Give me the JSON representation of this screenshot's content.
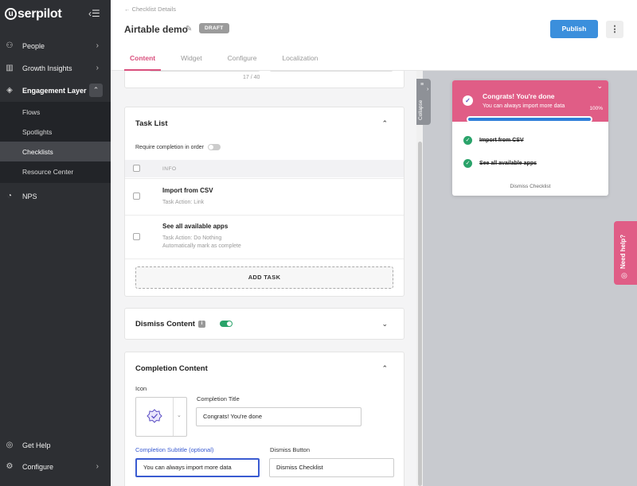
{
  "sidebar": {
    "logo": "serpilot",
    "logo_letter": "u",
    "collapse_icon": "‹☰",
    "items": [
      {
        "label": "People",
        "icon": "people-icon"
      },
      {
        "label": "Growth Insights",
        "icon": "chart-icon"
      },
      {
        "label": "Engagement Layer",
        "icon": "layers-icon"
      },
      {
        "label": "NPS",
        "icon": "nps-icon"
      }
    ],
    "subitems": [
      {
        "label": "Flows"
      },
      {
        "label": "Spotlights"
      },
      {
        "label": "Checklists"
      },
      {
        "label": "Resource Center"
      }
    ],
    "footer": [
      {
        "label": "Get Help",
        "icon": "help-icon"
      },
      {
        "label": "Configure",
        "icon": "gear-icon"
      }
    ]
  },
  "header": {
    "back_label": "← Checklist Details",
    "title": "Airtable demo",
    "badge": "DRAFT",
    "publish": "Publish",
    "more": "⋮",
    "tabs": [
      {
        "label": "Content"
      },
      {
        "label": "Widget"
      },
      {
        "label": "Configure"
      },
      {
        "label": "Localization"
      }
    ]
  },
  "content": {
    "char_count": "17 / 40",
    "task_list": {
      "title": "Task List",
      "require_completion": "Require completion in order",
      "require_completion_on": false,
      "column_header": "INFO",
      "tasks": [
        {
          "name": "Import from CSV",
          "action": "Task Action: Link",
          "extra": ""
        },
        {
          "name": "See all available apps",
          "action": "Task Action: Do Nothing",
          "extra": "Automatically mark as complete"
        }
      ],
      "add_task": "ADD TASK"
    },
    "dismiss": {
      "title": "Dismiss Content",
      "info": "i",
      "enabled": true
    },
    "completion": {
      "title": "Completion Content",
      "icon_label": "Icon",
      "title_label": "Completion Title",
      "title_value": "Congrats! You're done",
      "subtitle_label": "Completion Subtitle (optional)",
      "subtitle_value": "You can always import more data",
      "dismiss_label": "Dismiss Button",
      "dismiss_value": "Dismiss Checklist"
    }
  },
  "collapse_label": "Collapse",
  "preview": {
    "title": "Congrats! You're done",
    "subtitle": "You can always import more data",
    "percent": "100%",
    "progress": 1.0,
    "items": [
      {
        "label": "Import from CSV"
      },
      {
        "label": "See all available apps"
      }
    ],
    "dismiss": "Dismiss Checklist"
  },
  "need_help": "Need help?",
  "colors": {
    "accent": "#d94f7d",
    "primary": "#3b8fdc",
    "success": "#2aa36a",
    "sidebar": "#2d2f33"
  }
}
